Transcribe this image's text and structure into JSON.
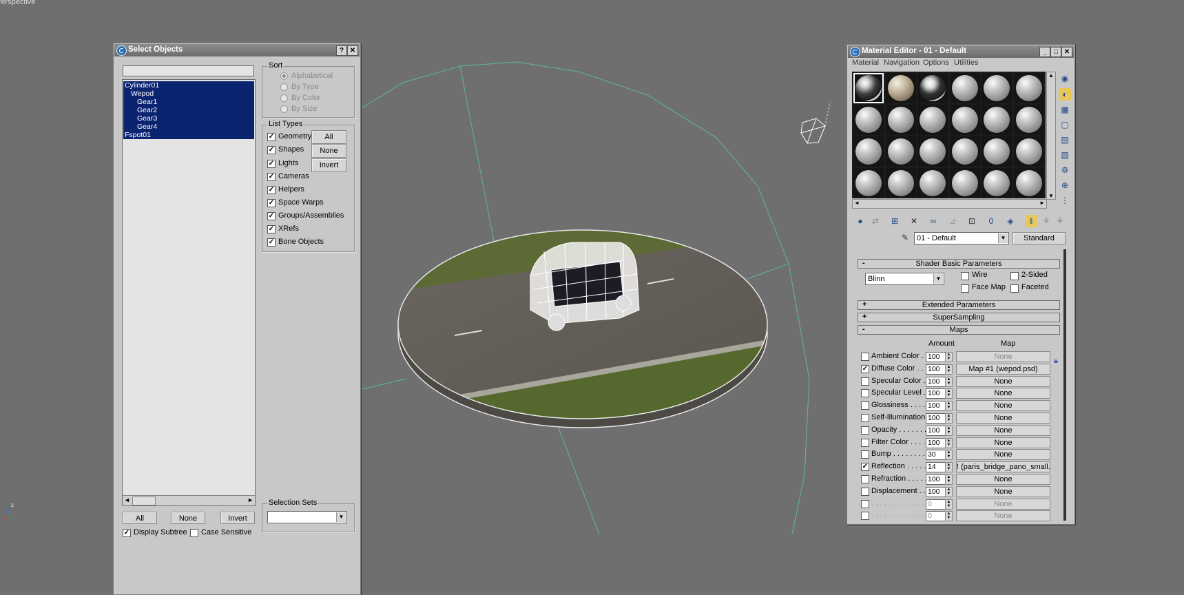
{
  "viewport": {
    "label": "Perspective"
  },
  "select_objects": {
    "title": "Select Objects",
    "help_label": "?",
    "close_label": "✕",
    "search_value": "",
    "objects": [
      {
        "name": "Cylinder01",
        "indent": 0
      },
      {
        "name": "Wepod",
        "indent": 1
      },
      {
        "name": "Gear1",
        "indent": 2
      },
      {
        "name": "Gear2",
        "indent": 2
      },
      {
        "name": "Gear3",
        "indent": 2
      },
      {
        "name": "Gear4",
        "indent": 2
      },
      {
        "name": "Fspot01",
        "indent": 0
      }
    ],
    "sort": {
      "title": "Sort",
      "options": [
        "Alphabetical",
        "By Type",
        "By Color",
        "By Size"
      ],
      "selected": "Alphabetical"
    },
    "list_types": {
      "title": "List Types",
      "items": [
        {
          "label": "Geometry",
          "checked": true
        },
        {
          "label": "Shapes",
          "checked": true
        },
        {
          "label": "Lights",
          "checked": true
        },
        {
          "label": "Cameras",
          "checked": true
        },
        {
          "label": "Helpers",
          "checked": true
        },
        {
          "label": "Space Warps",
          "checked": true
        },
        {
          "label": "Groups/Assemblies",
          "checked": true
        },
        {
          "label": "XRefs",
          "checked": true
        },
        {
          "label": "Bone Objects",
          "checked": true
        }
      ],
      "buttons": [
        "All",
        "None",
        "Invert"
      ]
    },
    "selection_sets": {
      "title": "Selection Sets",
      "value": ""
    },
    "bottom_buttons": [
      "All",
      "None",
      "Invert"
    ],
    "display_subtree": {
      "label": "Display Subtree",
      "checked": true
    },
    "case_sensitive": {
      "label": "Case Sensitive",
      "checked": false
    }
  },
  "material_editor": {
    "title": "Material Editor - 01 - Default",
    "menu": [
      "Material",
      "Navigation",
      "Options",
      "Utilities"
    ],
    "material_name": "01 - Default",
    "material_type": "Standard",
    "rollouts": {
      "shader_basic": "Shader Basic Parameters",
      "extended": "Extended Parameters",
      "supersampling": "SuperSampling",
      "maps": "Maps"
    },
    "shader": {
      "type": "Blinn",
      "wire": {
        "label": "Wire",
        "checked": false
      },
      "two_sided": {
        "label": "2-Sided",
        "checked": false
      },
      "face_map": {
        "label": "Face Map",
        "checked": false
      },
      "faceted": {
        "label": "Faceted",
        "checked": false
      }
    },
    "maps_header": {
      "amount": "Amount",
      "map": "Map"
    },
    "maps": [
      {
        "label": "Ambient Color . . .",
        "checked": false,
        "amount": "100",
        "map": "None",
        "dim": true
      },
      {
        "label": "Diffuse Color . . .",
        "checked": true,
        "amount": "100",
        "map": "Map #1 (wepod.psd)",
        "dim": false
      },
      {
        "label": "Specular Color . .",
        "checked": false,
        "amount": "100",
        "map": "None",
        "dim": false
      },
      {
        "label": "Specular Level . .",
        "checked": false,
        "amount": "100",
        "map": "None",
        "dim": false
      },
      {
        "label": "Glossiness . . . . .",
        "checked": false,
        "amount": "100",
        "map": "None",
        "dim": false
      },
      {
        "label": "Self-Illumination .",
        "checked": false,
        "amount": "100",
        "map": "None",
        "dim": false
      },
      {
        "label": "Opacity . . . . . . .",
        "checked": false,
        "amount": "100",
        "map": "None",
        "dim": false
      },
      {
        "label": "Filter Color . . . .",
        "checked": false,
        "amount": "100",
        "map": "None",
        "dim": false
      },
      {
        "label": "Bump . . . . . . . .",
        "checked": false,
        "amount": "30",
        "map": "None",
        "dim": false
      },
      {
        "label": "Reflection . . . . .",
        "checked": true,
        "amount": "14",
        "map": "! (paris_bridge_pano_small.hdr)",
        "dim": false
      },
      {
        "label": "Refraction . . . . .",
        "checked": false,
        "amount": "100",
        "map": "None",
        "dim": false
      },
      {
        "label": "Displacement . . .",
        "checked": false,
        "amount": "100",
        "map": "None",
        "dim": false
      },
      {
        "label": ". . . . . . . . . . . . .",
        "checked": false,
        "amount": "0",
        "map": "None",
        "dim": true
      },
      {
        "label": ". . . . . . . . . . . . .",
        "checked": false,
        "amount": "0",
        "map": "None",
        "dim": true
      }
    ]
  }
}
